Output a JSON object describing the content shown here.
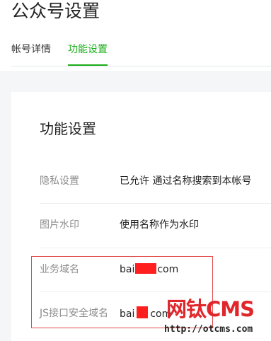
{
  "header": {
    "page_title": "公众号设置",
    "tabs": [
      {
        "label": "帐号详情",
        "active": false
      },
      {
        "label": "功能设置",
        "active": true
      }
    ]
  },
  "colors": {
    "accent": "#1aad19",
    "highlight_border": "#e24b4b",
    "redaction": "#ff1f1f",
    "watermark": "#e0262b"
  },
  "card": {
    "title": "功能设置",
    "rows": [
      {
        "label": "隐私设置",
        "value": "已允许 通过名称搜索到本帐号"
      },
      {
        "label": "图片水印",
        "value": "使用名称作为水印"
      },
      {
        "label": "业务域名",
        "value_prefix": "bai",
        "value_suffix": "com"
      },
      {
        "label": "JS接口安全域名",
        "value_prefix": "bai",
        "value_suffix": "com"
      }
    ]
  },
  "watermark": {
    "logo": "网钛CMS",
    "url": "http://otcms.com"
  }
}
